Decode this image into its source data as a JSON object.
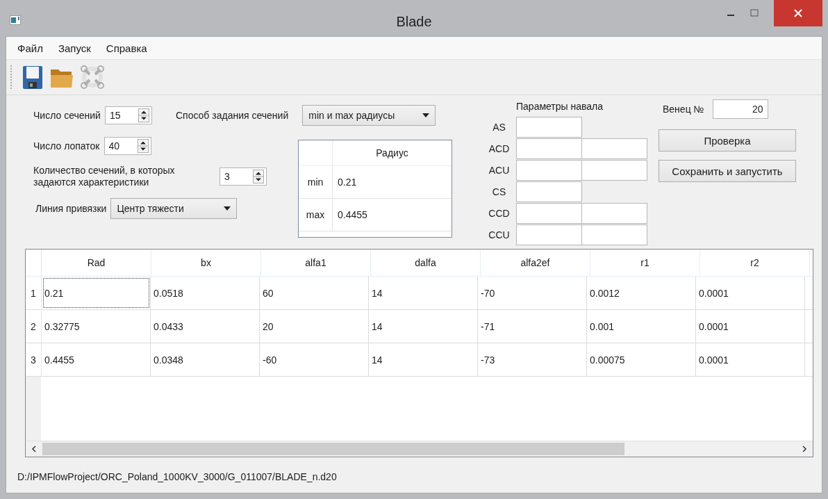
{
  "window": {
    "title": "Blade"
  },
  "menu": [
    "Файл",
    "Запуск",
    "Справка"
  ],
  "toolbar": [
    {
      "kind": "save",
      "disabled": false
    },
    {
      "kind": "open",
      "disabled": false
    },
    {
      "kind": "ring",
      "disabled": true
    }
  ],
  "sections": {
    "label": "Число сечений",
    "value": "15"
  },
  "blades": {
    "label": "Число лопаток",
    "value": "40"
  },
  "characteristic_sections": {
    "label": "Количество сечений, в которых задаются характеристики",
    "value": "3"
  },
  "section_mode": {
    "label": "Способ задания сечений",
    "value": "min и max радиусы"
  },
  "anchor_line": {
    "label": "Линия привязки",
    "value": "Центр тяжести"
  },
  "radius_table": {
    "column": "Радиус",
    "rows": [
      {
        "label": "min",
        "value": "0.21"
      },
      {
        "label": "max",
        "value": "0.4455"
      }
    ]
  },
  "camber": {
    "title": "Параметры навала",
    "rows": [
      {
        "label": "AS",
        "kind": "single"
      },
      {
        "label": "ACD",
        "kind": "double"
      },
      {
        "label": "ACU",
        "kind": "double"
      },
      {
        "label": "CS",
        "kind": "single"
      },
      {
        "label": "CCD",
        "kind": "double"
      },
      {
        "label": "CCU",
        "kind": "double"
      }
    ]
  },
  "crown": {
    "label": "Венец №",
    "value": "20"
  },
  "buttons": [
    "Проверка",
    "Сохранить и запустить"
  ],
  "table": {
    "columns": [
      "Rad",
      "bx",
      "alfa1",
      "dalfa",
      "alfa2ef",
      "r1",
      "r2"
    ],
    "rows": [
      {
        "number": "1",
        "cells": [
          {
            "text": "0.21",
            "focused": true
          },
          {
            "text": "0.0518",
            "focused": false
          },
          {
            "text": "60",
            "focused": false
          },
          {
            "text": "14",
            "focused": false
          },
          {
            "text": "-70",
            "focused": false
          },
          {
            "text": "0.0012",
            "focused": false
          },
          {
            "text": "0.0001",
            "focused": false
          }
        ]
      },
      {
        "number": "2",
        "cells": [
          {
            "text": "0.32775",
            "focused": false
          },
          {
            "text": "0.0433",
            "focused": false
          },
          {
            "text": "20",
            "focused": false
          },
          {
            "text": "14",
            "focused": false
          },
          {
            "text": "-71",
            "focused": false
          },
          {
            "text": "0.001",
            "focused": false
          },
          {
            "text": "0.0001",
            "focused": false
          }
        ]
      },
      {
        "number": "3",
        "cells": [
          {
            "text": "0.4455",
            "focused": false
          },
          {
            "text": "0.0348",
            "focused": false
          },
          {
            "text": "-60",
            "focused": false
          },
          {
            "text": "14",
            "focused": false
          },
          {
            "text": "-73",
            "focused": false
          },
          {
            "text": "0.00075",
            "focused": false
          },
          {
            "text": "0.0001",
            "focused": false
          }
        ]
      }
    ]
  },
  "status_bar": "D:/IPMFlowProject/ORC_Poland_1000KV_3000/G_011007/BLADE_n.d20"
}
